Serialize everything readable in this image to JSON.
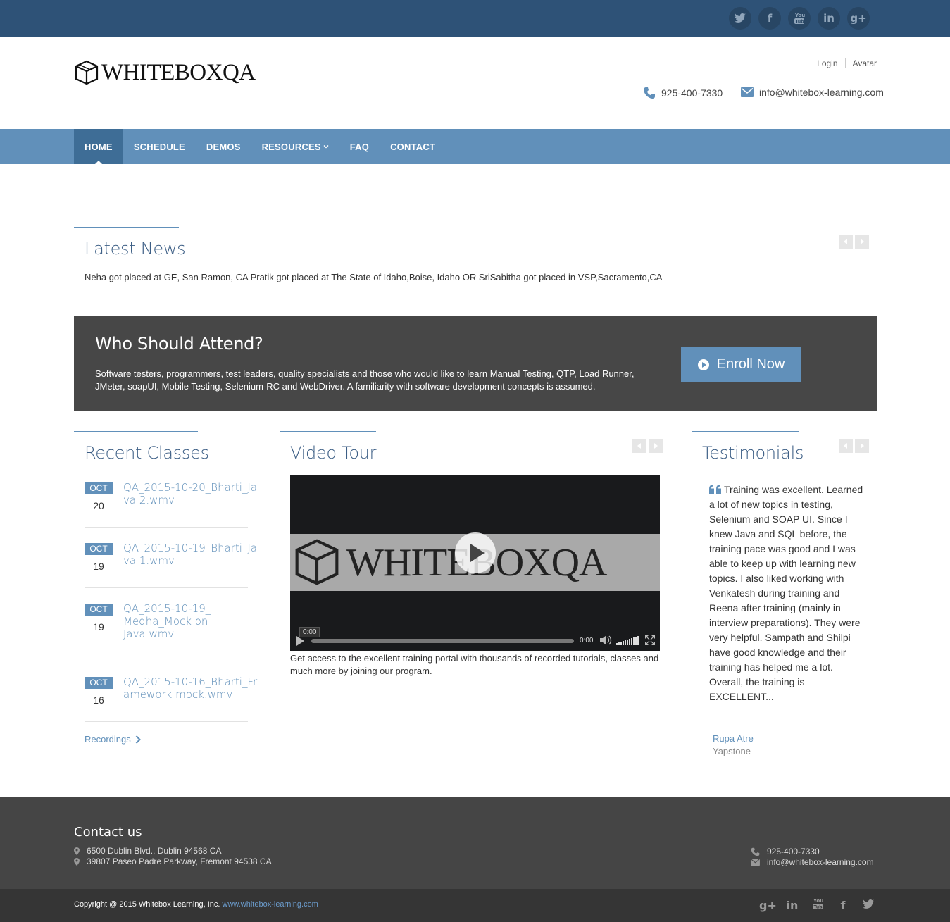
{
  "topbar": {
    "social": [
      "twitter-icon",
      "facebook-icon",
      "youtube-icon",
      "linkedin-icon",
      "google-plus-icon"
    ]
  },
  "header": {
    "logo_text": "WHITEBOXQA",
    "login": "Login",
    "avatar": "Avatar",
    "phone": "925-400-7330",
    "email": "info@whitebox-learning.com"
  },
  "nav": {
    "items": [
      {
        "label": "HOME",
        "active": true
      },
      {
        "label": "SCHEDULE"
      },
      {
        "label": "DEMOS"
      },
      {
        "label": "RESOURCES"
      },
      {
        "label": "FAQ"
      },
      {
        "label": "CONTACT"
      }
    ]
  },
  "news": {
    "title": "Latest News",
    "text": "Neha got placed at GE, San Ramon, CA Pratik got placed at The State of Idaho,Boise, Idaho OR SriSabitha got placed in VSP,Sacramento,CA"
  },
  "attend": {
    "title": "Who Should Attend?",
    "text": "Software testers, programmers, test leaders, quality specialists and those who would like to learn Manual Testing, QTP, Load Runner, JMeter, soapUI, Mobile Testing, Selenium-RC and WebDriver. A familiarity with software development concepts is assumed.",
    "button": "Enroll Now"
  },
  "recent": {
    "title": "Recent Classes",
    "items": [
      {
        "month": "OCT",
        "day": "20",
        "title": "QA_2015-10-20_Bharti_Java 2.wmv"
      },
      {
        "month": "OCT",
        "day": "19",
        "title": "QA_2015-10-19_Bharti_Java 1.wmv"
      },
      {
        "month": "OCT",
        "day": "19",
        "title": "QA_2015-10-19_ Medha_Mock on Java.wmv"
      },
      {
        "month": "OCT",
        "day": "16",
        "title": "QA_2015-10-16_Bharti_Framework mock.wmv"
      }
    ],
    "more": "Recordings"
  },
  "video": {
    "title": "Video Tour",
    "logo_text": "WHITEBOXQA",
    "time_tip": "0:00",
    "current_time": "0:00",
    "volume_level": 1.0,
    "caption": "Get access to the excellent training portal with thousands of recorded tutorials, classes and much more by joining our program."
  },
  "testimonials": {
    "title": "Testimonials",
    "text": "Training was excellent. Learned a lot of new topics in testing, Selenium and SOAP UI. Since I knew Java and SQL before, the training pace was good and I was able to keep up with learning new topics. I also liked working with Venkatesh during training and Reena after training (mainly in interview preparations). They were very helpful. Sampath and Shilpi have good knowledge and their training has helped me a lot. Overall, the training is EXCELLENT...",
    "name": "Rupa Atre",
    "company": "Yapstone"
  },
  "footer": {
    "title": "Contact us",
    "address1": "6500 Dublin Blvd., Dublin 94568 CA",
    "address2": "39807 Paseo Padre Parkway, Fremont 94538 CA",
    "phone": "925-400-7330",
    "email": "info@whitebox-learning.com",
    "copyright": "Copyright @ 2015 Whitebox Learning, Inc.",
    "site": "www.whitebox-learning.com",
    "social": [
      "google-plus-icon",
      "linkedin-icon",
      "youtube-icon",
      "facebook-icon",
      "twitter-icon"
    ]
  },
  "colors": {
    "topbar": "#2e5277",
    "nav": "#6190ba",
    "nav_active": "#3e6d96",
    "accent": "#6190ba",
    "attend_bg": "#474747",
    "footer": "#454545",
    "bottombar": "#353535"
  }
}
